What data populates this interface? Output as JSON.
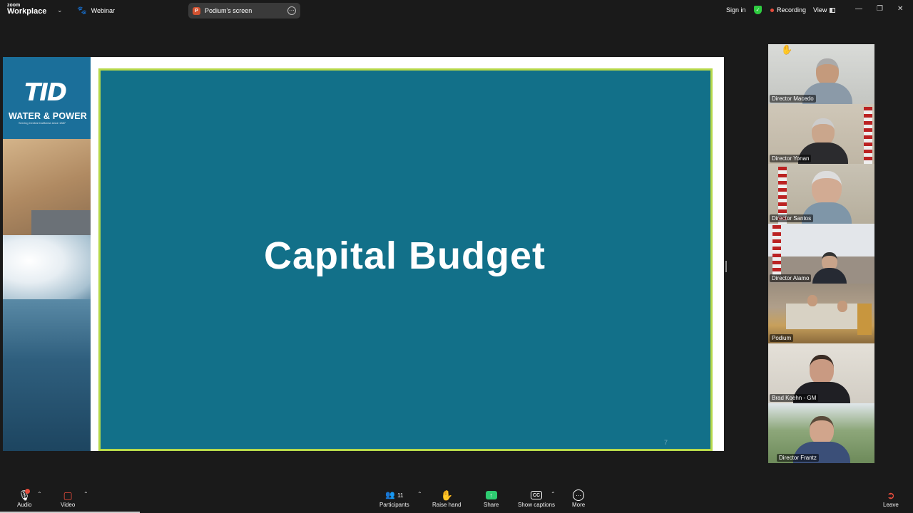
{
  "header": {
    "brand_top": "zoom",
    "brand_bottom": "Workplace",
    "webinar_label": "Webinar",
    "share_pill_label": "Podium's screen",
    "share_pill_app_letter": "P",
    "sign_in": "Sign in",
    "recording": "Recording",
    "view": "View"
  },
  "slide": {
    "logo_text": "TID",
    "org_name": "WATER & POWER",
    "tagline": "Serving Central California since 1887",
    "title": "Capital Budget",
    "page_number": "7"
  },
  "participants_tiles": [
    {
      "name": "Director Macedo"
    },
    {
      "name": "Director Yonan"
    },
    {
      "name": "Director Santos"
    },
    {
      "name": "Director Alamo"
    },
    {
      "name": "Podium"
    },
    {
      "name": "Brad Koehn - GM"
    },
    {
      "name": "Director Frantz"
    }
  ],
  "toolbar": {
    "audio": "Audio",
    "video": "Video",
    "participants": "Participants",
    "participants_count": "11",
    "raise_hand": "Raise hand",
    "share": "Share",
    "show_captions": "Show captions",
    "captions_icon": "CC",
    "more": "More",
    "leave": "Leave"
  }
}
